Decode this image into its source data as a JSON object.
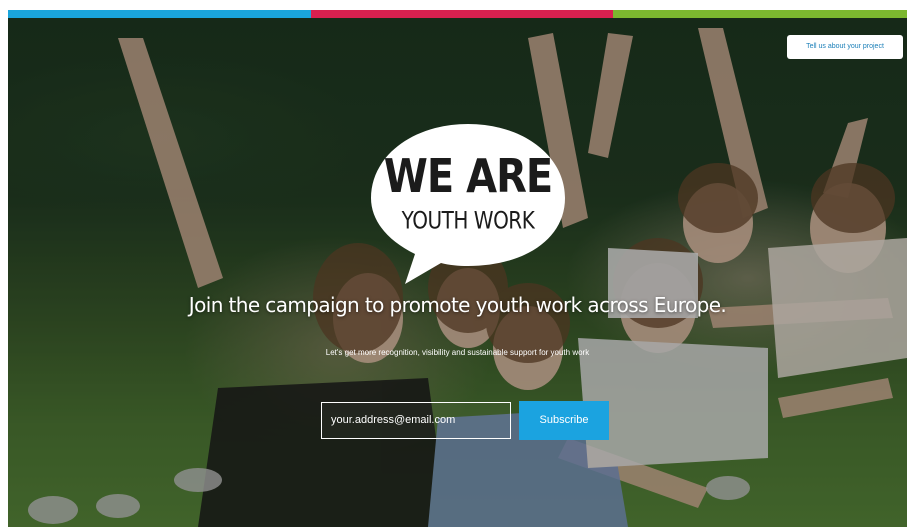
{
  "header": {
    "cta_label": "Tell us about your project",
    "stripe_colors": [
      "#1aa5dc",
      "#d8204f",
      "#7cb82f"
    ]
  },
  "logo": {
    "line1": "WE ARE",
    "line2": "YOUTH WORK"
  },
  "hero": {
    "headline": "Join the campaign to promote youth work across Europe.",
    "subheadline": "Let's get more recognition, visibility and sustainable support for youth work"
  },
  "signup": {
    "email_placeholder": "your.address@email.com",
    "subscribe_label": "Subscribe",
    "accent_color": "#1ba3e0"
  }
}
